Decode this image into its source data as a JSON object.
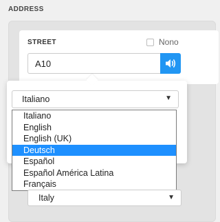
{
  "address": {
    "section_title": "ADDRESS"
  },
  "street": {
    "label": "STREET",
    "none_label": "Nono",
    "value": "A10",
    "speak_icon": "speaker-icon",
    "accent": "#2196f3"
  },
  "language_select": {
    "value": "Italiano",
    "options": [
      {
        "label": "Italiano"
      },
      {
        "label": "English"
      },
      {
        "label": "English (UK)"
      },
      {
        "label": "Deutsch",
        "selected": true
      },
      {
        "label": "Español"
      },
      {
        "label": "Español América Latina"
      },
      {
        "label": "Français"
      }
    ]
  },
  "country_select": {
    "value": "Italy"
  },
  "icons": {
    "dropdown": "▼"
  }
}
